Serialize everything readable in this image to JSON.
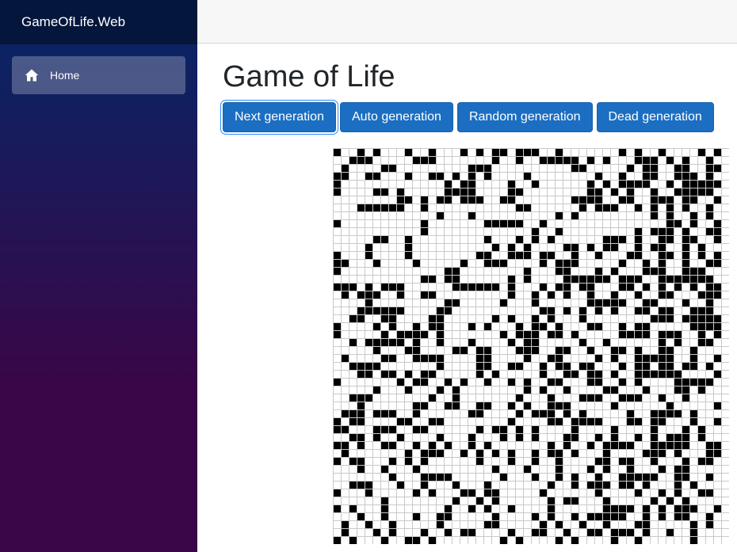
{
  "brand": "GameOfLife.Web",
  "nav": {
    "items": [
      {
        "label": "Home",
        "icon": "home-icon",
        "active": true
      }
    ]
  },
  "page": {
    "title": "Game of Life"
  },
  "buttons": {
    "next": "Next generation",
    "auto": "Auto generation",
    "random": "Random generation",
    "dead": "Dead generation"
  },
  "board": {
    "cols": 50,
    "rows": 50,
    "alive_color": "#000000",
    "dead_color": "#ffffff",
    "rows_data": [
      "X..X.X...X..X...X.X.XX.XXX..X.......X.X..X....X.X",
      "..XXX.....XXX.......X..X..XXXXX.X.X...XXX.X.X..X.",
      ".X....XX.........XXX..........XX.....X.XX..XX..XX",
      "XX..XX...X..XX.X.X.X....X........X..X..XX..XXX.X.",
      "X.............X.XX....X..X......X.X.XXXX..X.XXXXX",
      "X....XX.X.....XXXX....XX........XX.X.X..X..XXXXX.",
      "........XX.X.XX.XXX..XX.......XXXX..XX..XXX.XX..X",
      "...XXXXXX..X...........XX......X.XXX..X.X.X.X..X.",
      ".............X...X..........X.X.........X.X..X.X.",
      "X..........X.......XXXXX..X...............XX.X..X",
      "...........X.............X..X.........X.XXX.X..XX",
      ".....XX..X.........X...X.X.X......XXX.X..XX.XX..X",
      "....X....X..........X.X.X....XX.X.XX..X.XX..X.X..",
      "X...X....X........XX..XXX.XX..X..X...XX..XX.X.X.X",
      "XX...X....X.....X..XXX....X.XXX.....X..X.X..X..XX",
      "X.............XX........X...XX...X.X...XXX..XXX..",
      "...........XX.XX......X.X....XXXXXX.XXX..XXXXXXX.",
      "XXX.X.XXX......XXXXXX.X...X.XX.XX...XX.X.X.X.X.XX",
      ".X.XXX..X..XX.........X..X.X.X..X..X..X..XX...XXX",
      "....X.........XX.....X...X......XXXXX..XX...X..X.",
      "...XXXXXX....XX...........XX.X.X.X.X..XX.XX..XXX",
      "..XX..XX....XX......X.X..X.X...X........XXX.XXXXX",
      "X....X.X..X.XX...X.X...X.XX.X...XX..X.XX.....XXXX",
      "X.....X.XXXX.X.......X.XXX.XX.X.....XXXX.XXX..X.X",
      "..X.XXXXX.X..X...X....X.XX.....X..X......X.X..XX.",
      ".....X...XX....XX.XX...XXX..XX..X..XX.X..XX..X...",
      ".X....XX..XXXX....XX....X..XX....X.X..XXXXX..X..X",
      "..XXXX.......X....XX..XX..X.XX.XX...X.XX.XX.XX.X.",
      "...XX.XX.X.XX.....X.X.....X..XX.XX.X..XXXXXX....X",
      "X.......X.XX..X.X..X..X.X..XX...XX..X.X....XXXXX.",
      ".....X...X...X.X........X.X..X....XX...X...XX.X..",
      "..XXX.......X..X.......X...X...XXX..XXX..X..X....",
      "...X......XX..XX..XX..X.X..XXX.....X......X.....X",
      ".XXX.XXX..X......XX....X.XXX.X.X.....X..XXXX.X...",
      "X.XX....XX..XX........X....XX.XXXX...XX.XX...X..X",
      "XX...XXX..XX......X.XX.X.X....X....X....X...X.X..",
      "..XX.X..X....X...X...X.X.X...XX..X.X..X.X.XXX.X..",
      "XX.X..XX..X.X.X..X.X.......X.X..X.XXXX..XXXXX..XX",
      ".X.......X.XXX..X.X.X.X..X.XX.X...X....XXX.X...XX",
      "X.XX...X.X.X......X...X..X..X....XX.XX..X...X.XX.",
      "...X..X...X.........X...X...X...X.X..X...X.XX....",
      ".......X...XXXX......X...X..X.X..X..XXXXX..XX..X.",
      "..XXX...X..X...X...X.......X..X.XXX.XX.X...X.X...",
      "X...X.....X.X...XX.XX.....X......X....X..X.X..XX.",
      "......X........X..X.X......X.XX...X.....X.X.X....",
      "X.X...X.......X..X.X..X....X......XXXX.X.X.XXX..X",
      "...X..X...X..XX.....X....X.X..X.XXXXX..X.X.XX..X.",
      ".X..X..X.....X.....XX.....X.X..X..X...XX.....X.X.",
      ".X...X.X...X..X.XX....X..XX..X..XX.XXX.X..X..X...",
      "X.X...X..XX.X........X.X....X.X....X..X......X..."
    ]
  }
}
